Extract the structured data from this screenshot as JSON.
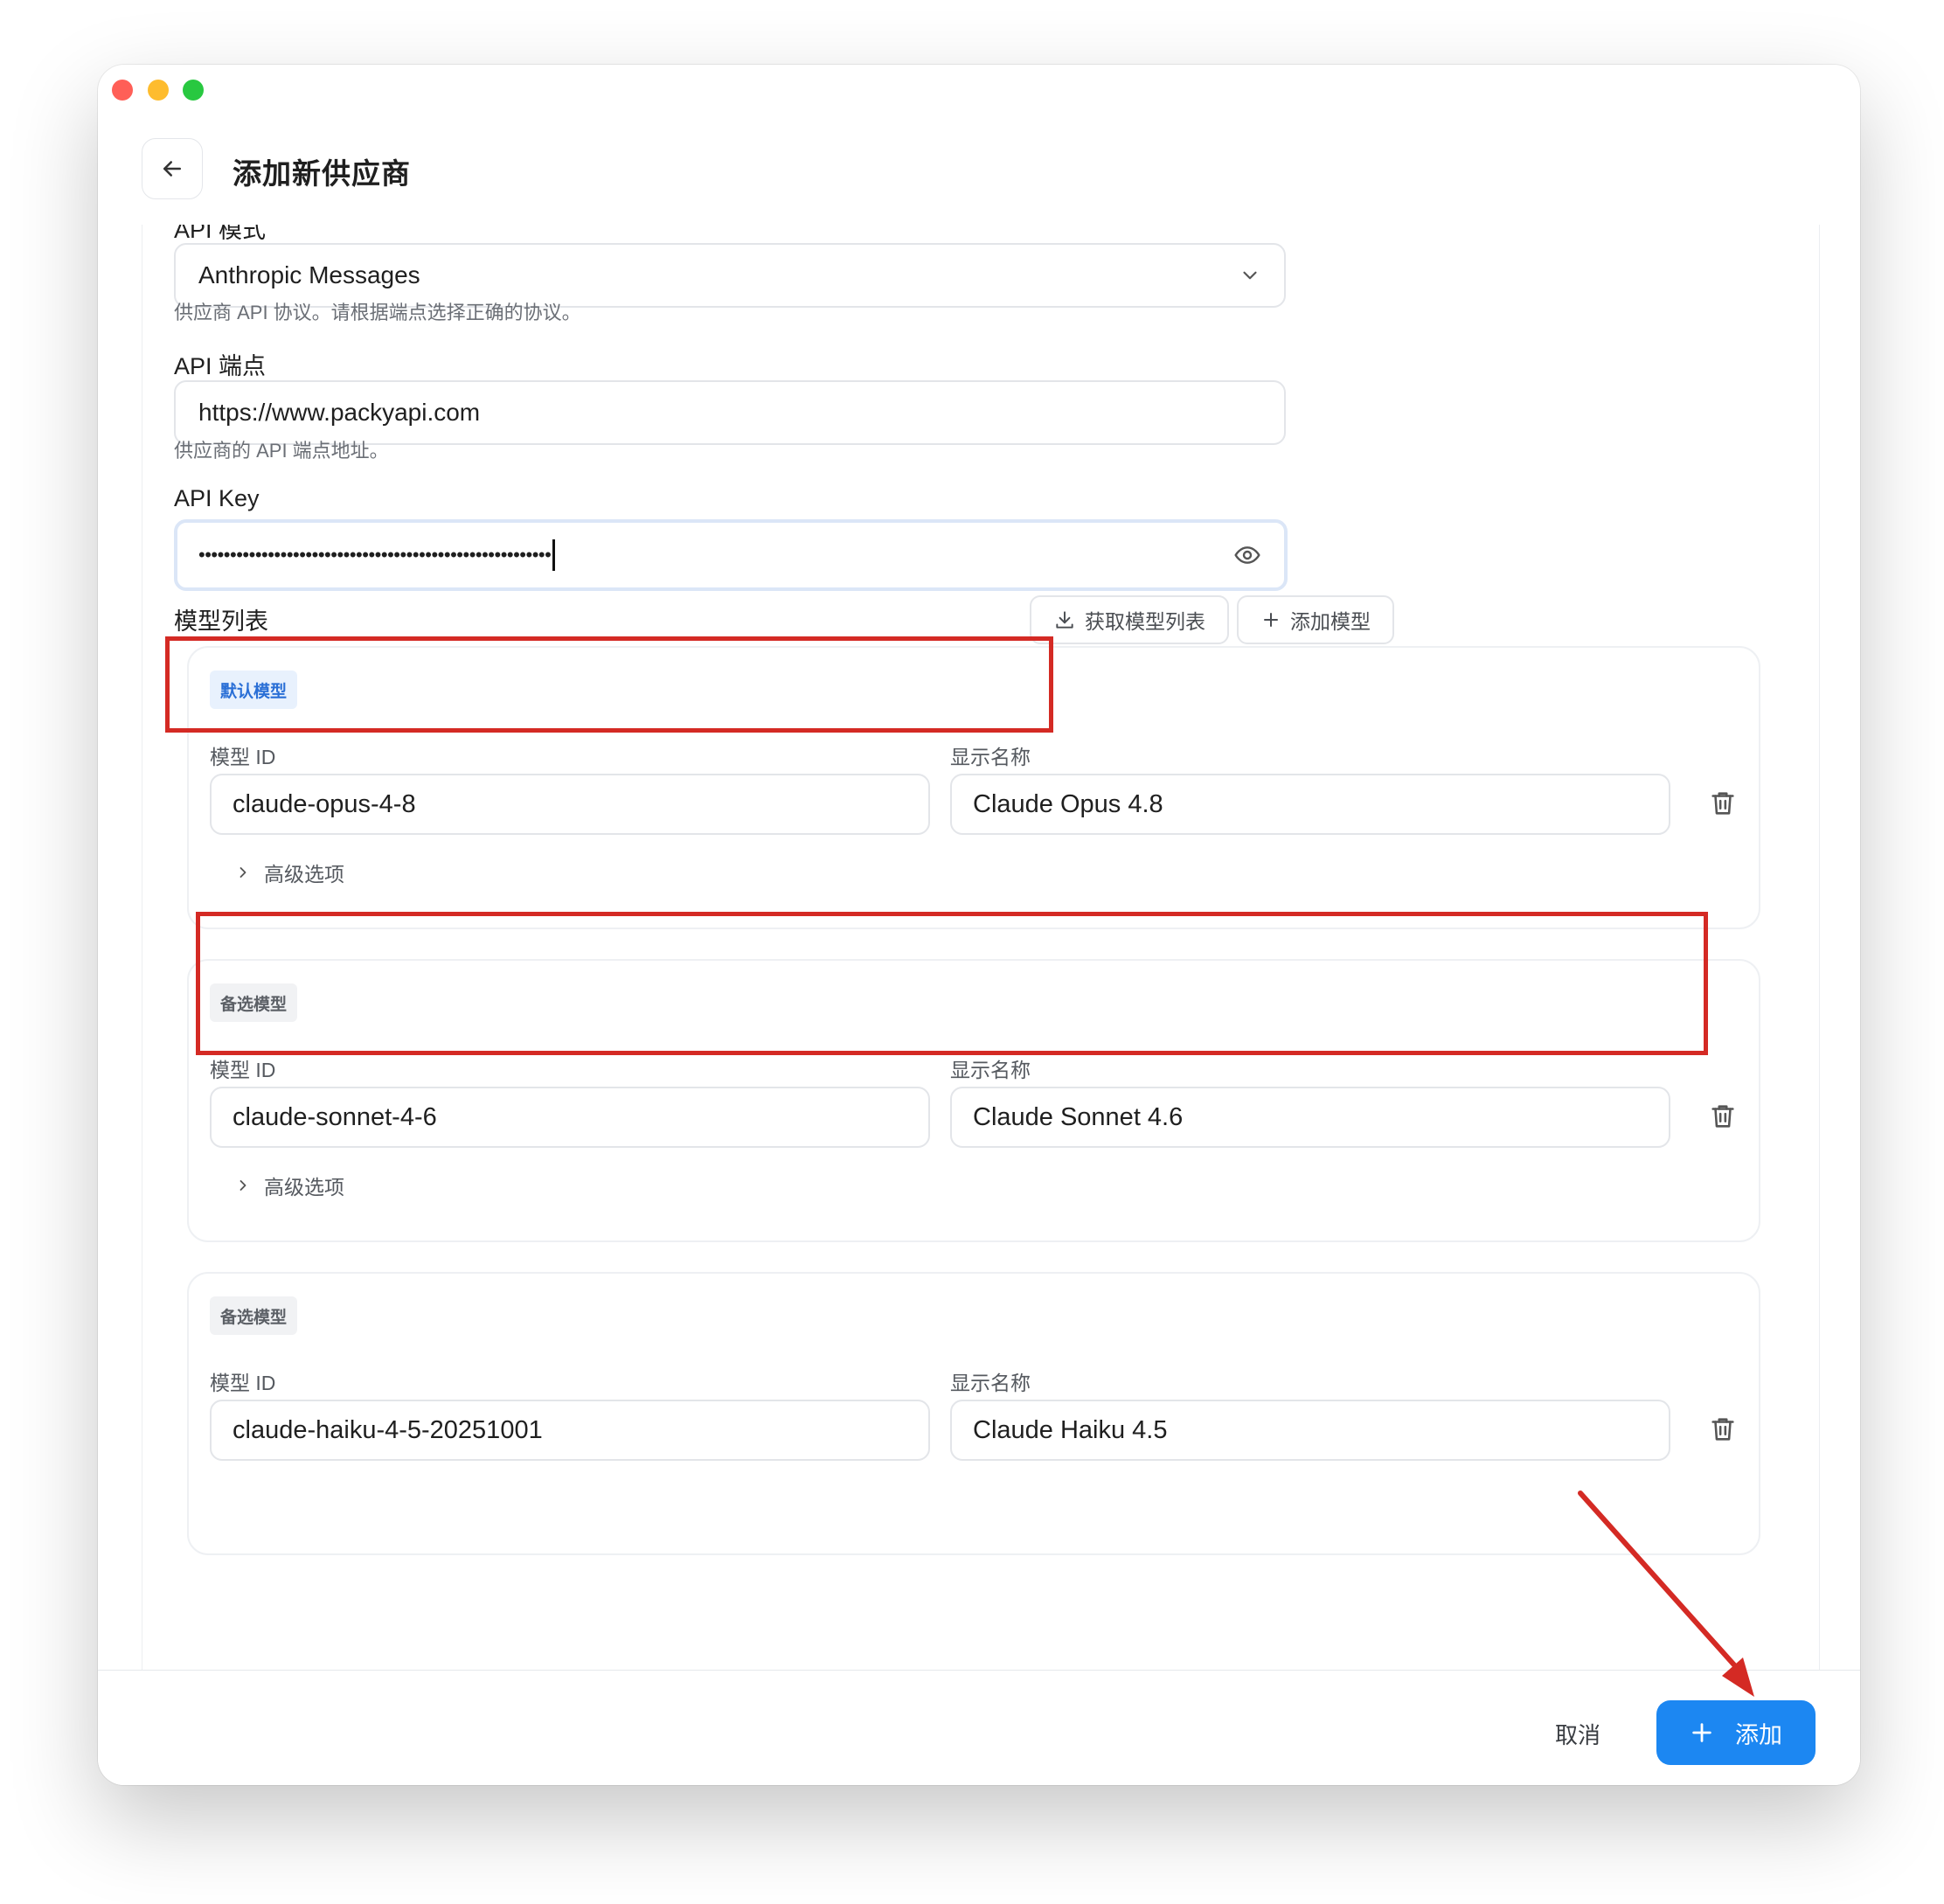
{
  "window": {
    "title": "添加新供应商"
  },
  "api_mode": {
    "label_partial": "API 模式",
    "value": "Anthropic Messages",
    "hint": "供应商 API 协议。请根据端点选择正确的协议。"
  },
  "endpoint": {
    "label": "API 端点",
    "value": "https://www.packyapi.com",
    "hint": "供应商的 API 端点地址。"
  },
  "api_key": {
    "label": "API Key",
    "masked_value": "••••••••••••••••••••••••••••••••••••••••••••••••••••••••"
  },
  "models": {
    "section_label": "模型列表",
    "fetch_button": "获取模型列表",
    "add_button": "添加模型",
    "id_label": "模型 ID",
    "name_label": "显示名称",
    "advanced_label": "高级选项",
    "items": [
      {
        "badge": "默认模型",
        "badge_type": "default",
        "id": "claude-opus-4-8",
        "name": "Claude Opus 4.8"
      },
      {
        "badge": "备选模型",
        "badge_type": "backup",
        "id": "claude-sonnet-4-6",
        "name": "Claude Sonnet 4.6"
      },
      {
        "badge": "备选模型",
        "badge_type": "backup",
        "id": "claude-haiku-4-5-20251001",
        "name": "Claude Haiku 4.5"
      }
    ]
  },
  "footer": {
    "cancel": "取消",
    "add": "添加"
  },
  "colors": {
    "accent": "#1c87f2",
    "annotation": "#d42a24"
  }
}
